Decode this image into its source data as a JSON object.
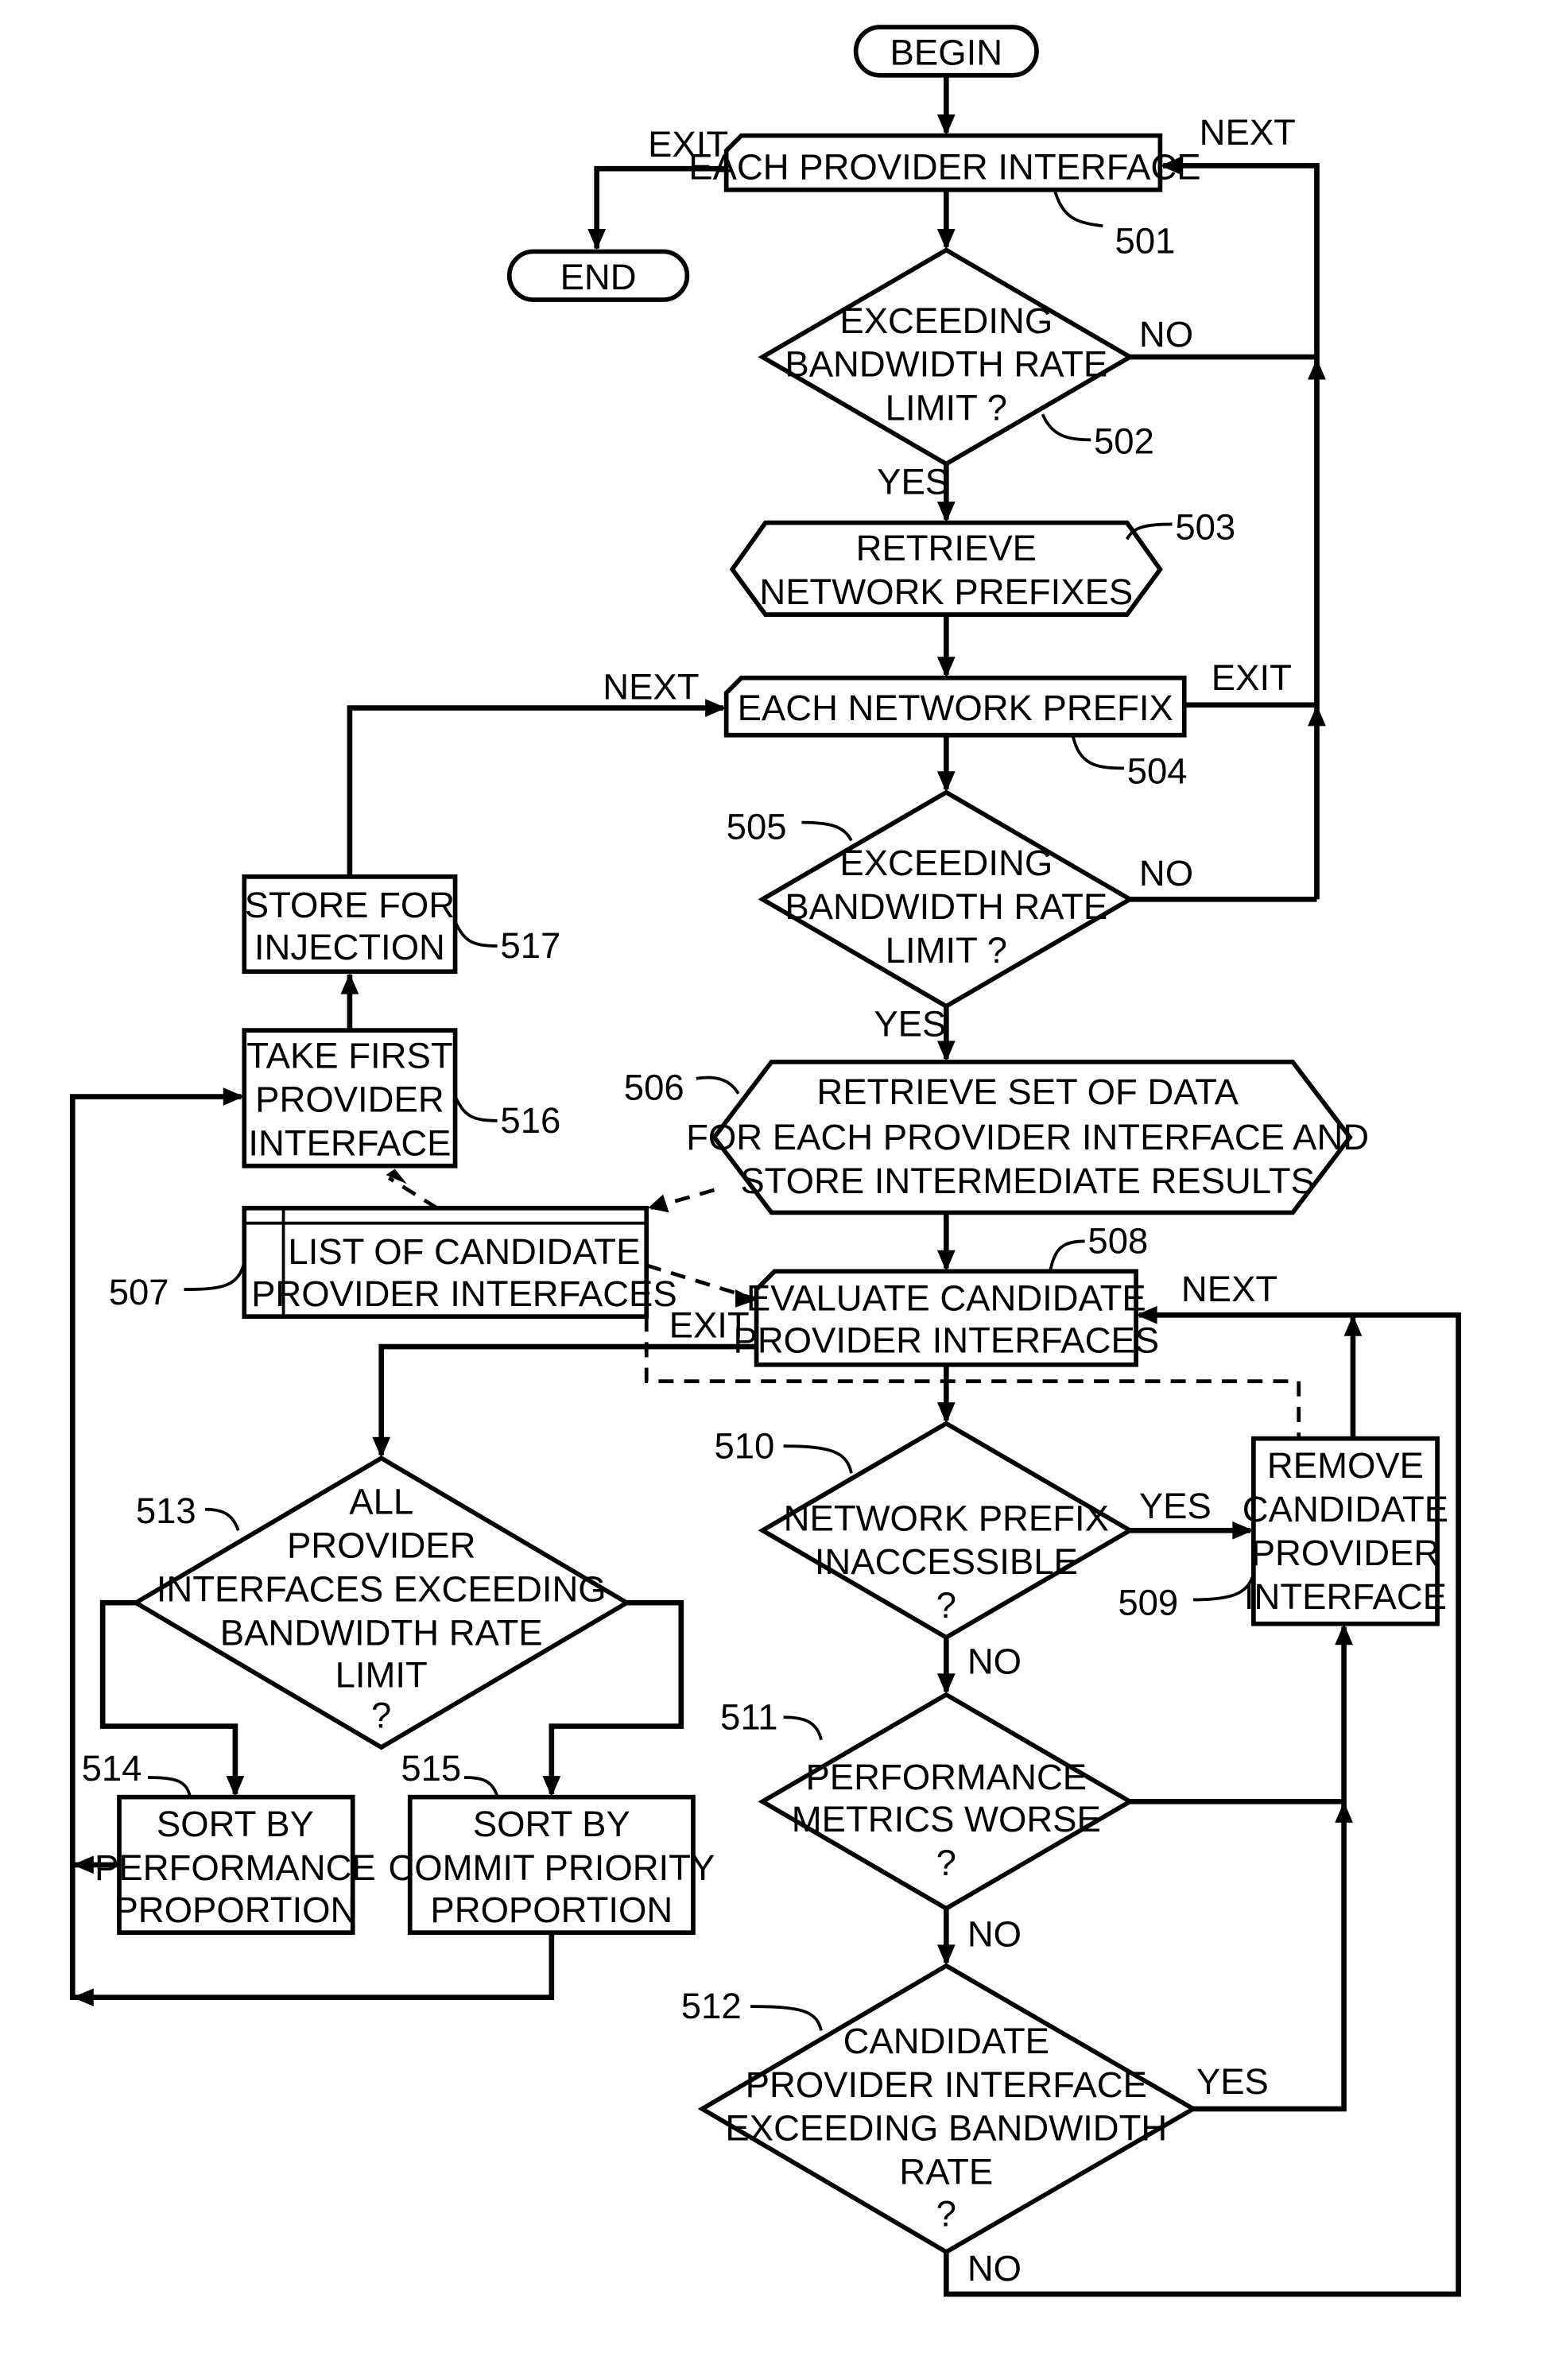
{
  "nodes": {
    "begin": "BEGIN",
    "end": "END",
    "n501": {
      "lines": [
        "EACH  PROVIDER  INTERFACE"
      ],
      "ref": "501"
    },
    "n502": {
      "lines": [
        "EXCEEDING",
        "BANDWIDTH  RATE",
        "LIMIT ?"
      ],
      "ref": "502"
    },
    "n503": {
      "lines": [
        "RETRIEVE",
        "NETWORK  PREFIXES"
      ],
      "ref": "503"
    },
    "n504": {
      "lines": [
        "EACH  NETWORK  PREFIX"
      ],
      "ref": "504"
    },
    "n505": {
      "lines": [
        "EXCEEDING",
        "BANDWIDTH  RATE",
        "LIMIT ?"
      ],
      "ref": "505"
    },
    "n506": {
      "lines": [
        "RETRIEVE  SET  OF  DATA",
        "FOR  EACH  PROVIDER  INTERFACE  AND",
        "STORE  INTERMEDIATE  RESULTS"
      ],
      "ref": "506"
    },
    "n507": {
      "lines": [
        "LIST  OF  CANDIDATE",
        "PROVIDER  INTERFACES"
      ],
      "ref": "507"
    },
    "n508": {
      "lines": [
        "EVALUATE  CANDIDATE",
        "PROVIDER  INTERFACES"
      ],
      "ref": "508"
    },
    "n509": {
      "lines": [
        "REMOVE",
        "CANDIDATE",
        "PROVIDER",
        "INTERFACE"
      ],
      "ref": "509"
    },
    "n510": {
      "lines": [
        "NETWORK  PREFIX",
        "INACCESSIBLE",
        "?"
      ],
      "ref": "510"
    },
    "n511": {
      "lines": [
        "PERFORMANCE",
        "METRICS  WORSE",
        "?"
      ],
      "ref": "511"
    },
    "n512": {
      "lines": [
        "CANDIDATE",
        "PROVIDER  INTERFACE",
        "EXCEEDING  BANDWIDTH",
        "RATE",
        "?"
      ],
      "ref": "512"
    },
    "n513": {
      "lines": [
        "ALL",
        "PROVIDER",
        "INTERFACES  EXCEEDING",
        "BANDWIDTH  RATE",
        "LIMIT",
        "?"
      ],
      "ref": "513"
    },
    "n514": {
      "lines": [
        "SORT  BY",
        "PERFORMANCE",
        "PROPORTION"
      ],
      "ref": "514"
    },
    "n515": {
      "lines": [
        "SORT  BY",
        "COMMIT  PRIORITY",
        "PROPORTION"
      ],
      "ref": "515"
    },
    "n516": {
      "lines": [
        "TAKE  FIRST",
        "PROVIDER",
        "INTERFACE"
      ],
      "ref": "516"
    },
    "n517": {
      "lines": [
        "STORE  FOR",
        "INJECTION"
      ],
      "ref": "517"
    }
  },
  "edge_labels": {
    "exit_501": "EXIT",
    "next_501": "NEXT",
    "no_502": "NO",
    "yes_502": "YES",
    "next_504": "NEXT",
    "exit_504": "EXIT",
    "no_505": "NO",
    "yes_505": "YES",
    "next_508": "NEXT",
    "exit_508": "EXIT",
    "yes_510": "YES",
    "no_510": "NO",
    "no_511": "NO",
    "yes_512": "YES",
    "no_512": "NO"
  }
}
